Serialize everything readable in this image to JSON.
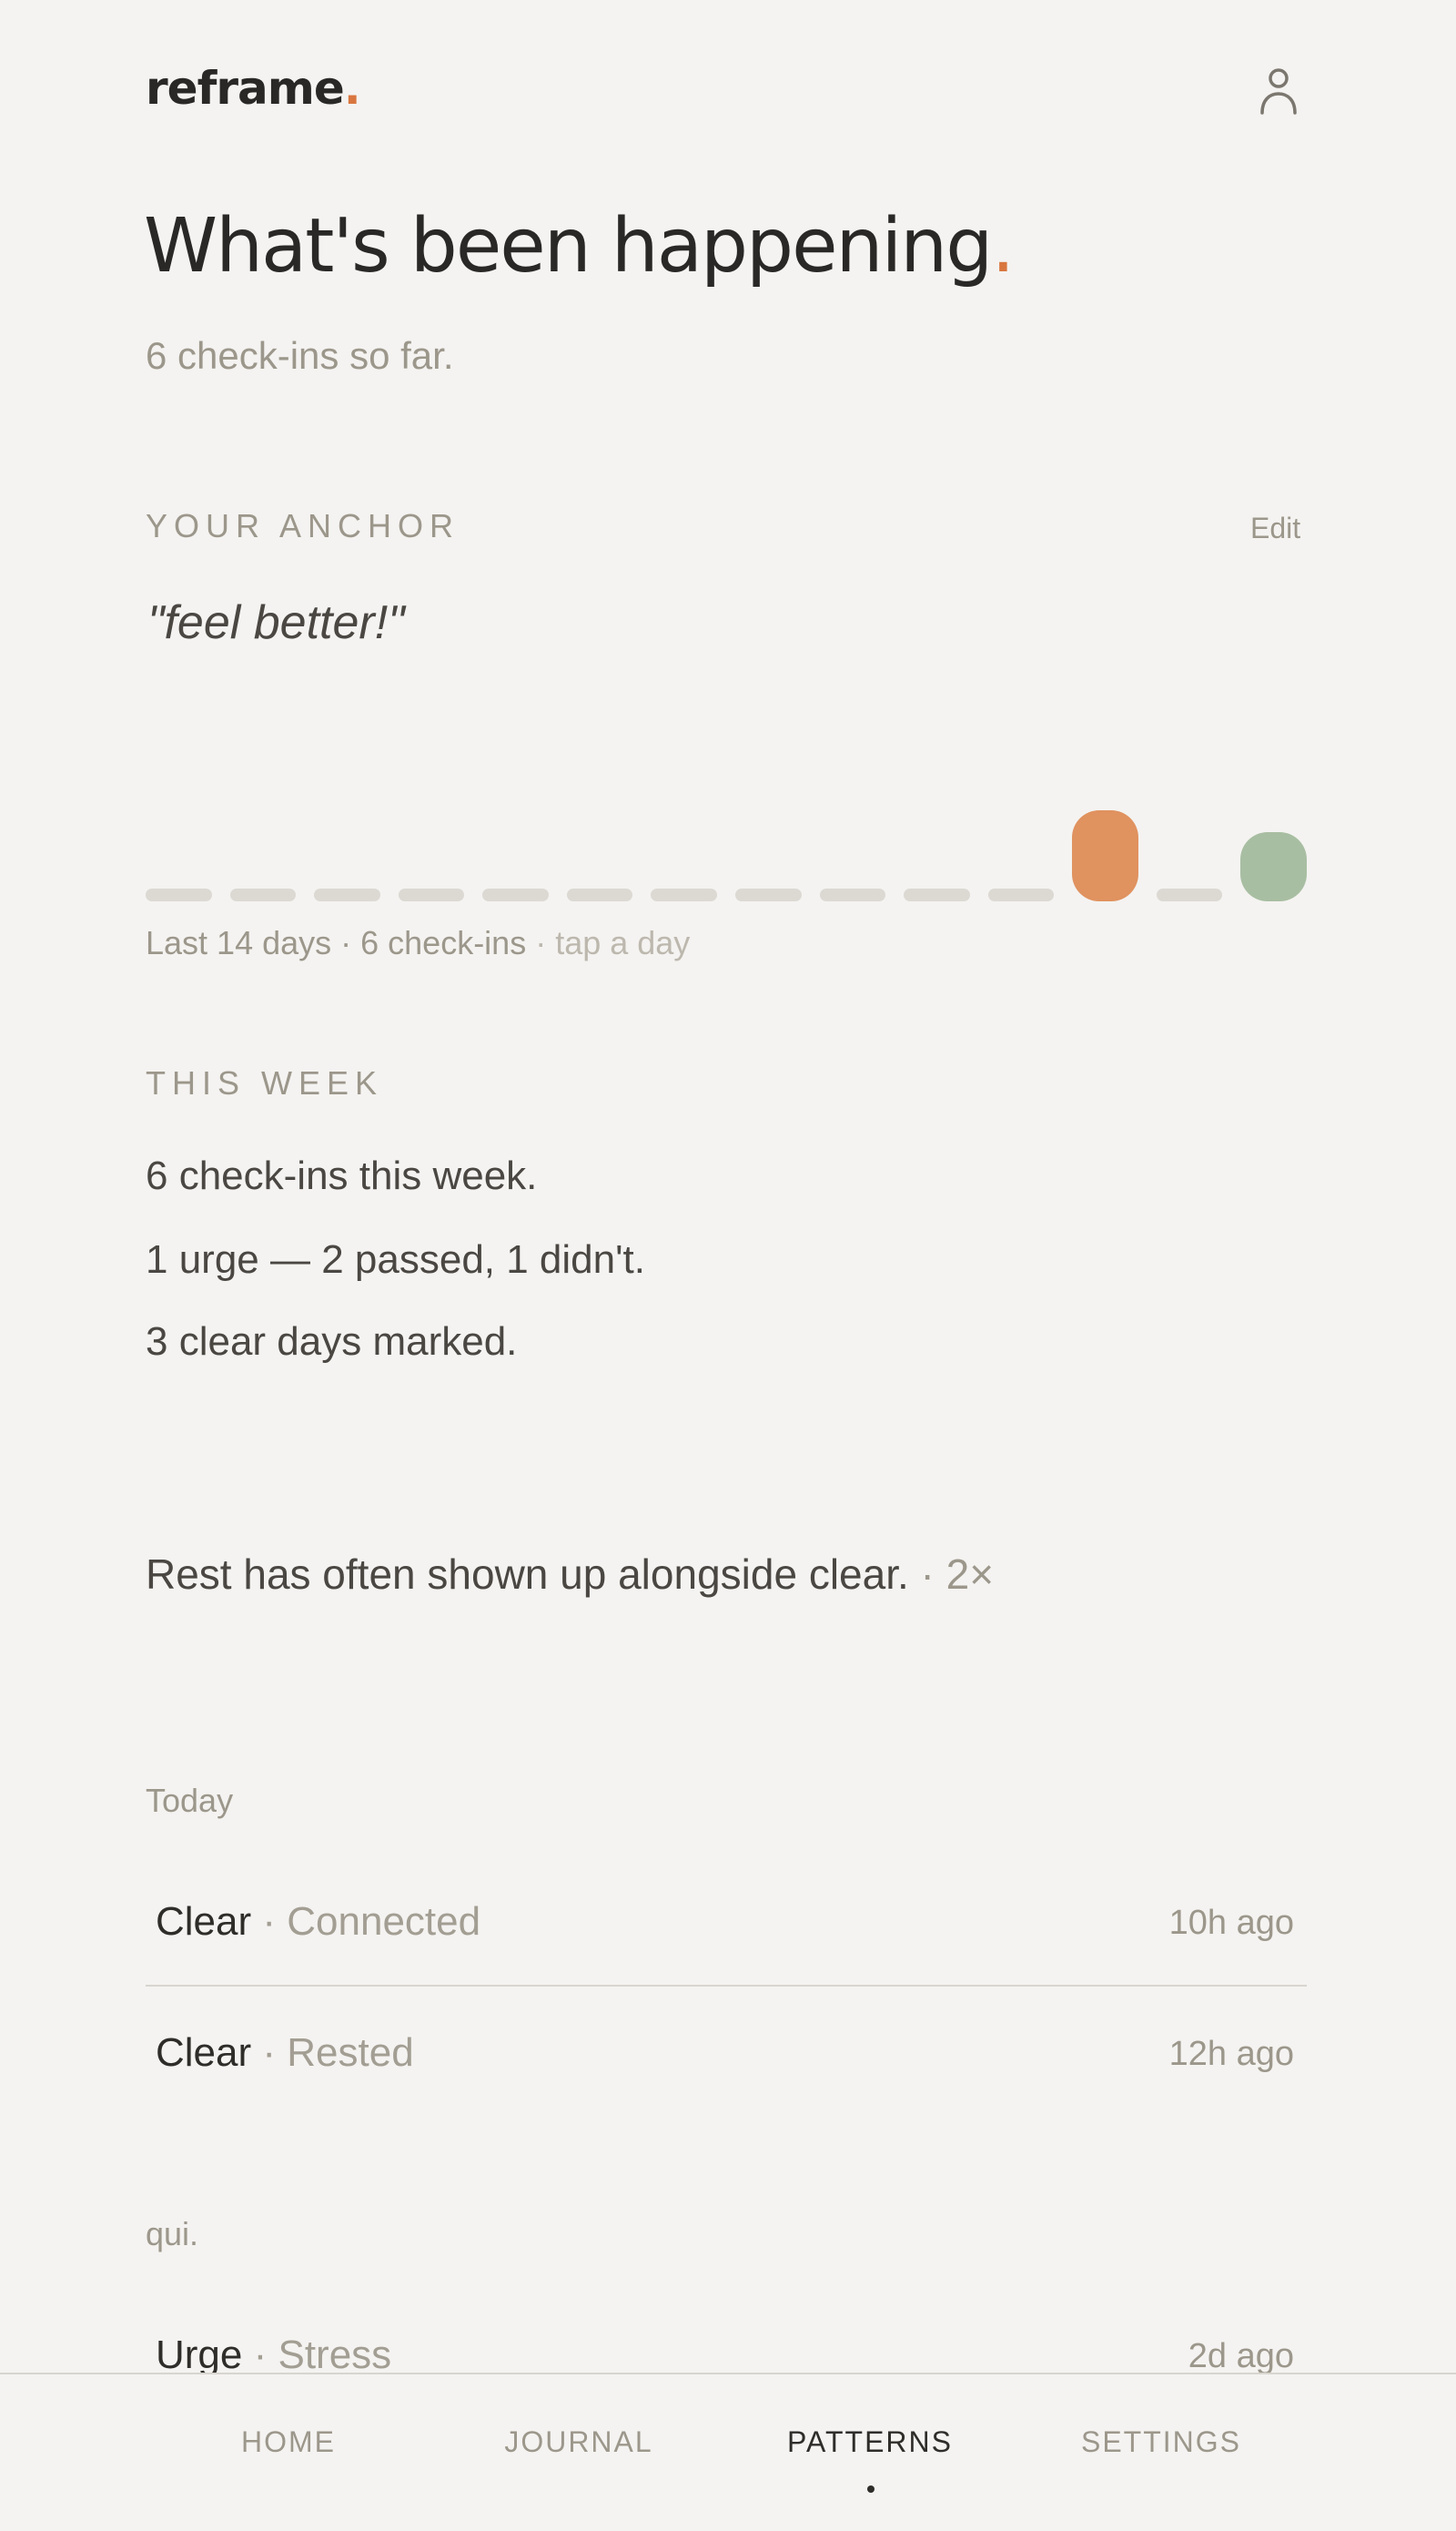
{
  "app": {
    "logo_text": "reframe",
    "logo_dot": "."
  },
  "header": {
    "title": "What's been happening",
    "title_dot": ".",
    "subtitle": "6 check-ins so far."
  },
  "anchor": {
    "label": "YOUR ANCHOR",
    "edit_label": "Edit",
    "quote": "\"feel better!\""
  },
  "day_strip": {
    "colors": {
      "empty": "#dcd9d3",
      "urge": "#e0925f",
      "clear": "#a8bea2"
    },
    "days": [
      {
        "state": "empty"
      },
      {
        "state": "empty"
      },
      {
        "state": "empty"
      },
      {
        "state": "empty"
      },
      {
        "state": "empty"
      },
      {
        "state": "empty"
      },
      {
        "state": "empty"
      },
      {
        "state": "empty"
      },
      {
        "state": "empty"
      },
      {
        "state": "empty"
      },
      {
        "state": "empty"
      },
      {
        "state": "urge"
      },
      {
        "state": "empty"
      },
      {
        "state": "clear"
      }
    ],
    "caption_main": "Last 14 days · 6 check-ins",
    "caption_hint": " · tap a day"
  },
  "this_week": {
    "label": "THIS WEEK",
    "lines": [
      "6 check-ins this week.",
      "1 urge — 2 passed, 1 didn't.",
      "3 clear days marked."
    ]
  },
  "insight": {
    "text": "Rest has often shown up alongside clear.",
    "count": " · 2×"
  },
  "timeline": {
    "groups": [
      {
        "label": "Today",
        "entries": [
          {
            "kind": "Clear",
            "tag": "Connected",
            "time": "10h ago"
          },
          {
            "kind": "Clear",
            "tag": "Rested",
            "time": "12h ago"
          }
        ]
      },
      {
        "label": "qui.",
        "entries": [
          {
            "kind": "Urge",
            "tag": "Stress",
            "time": "2d ago"
          }
        ]
      }
    ],
    "separator": " · "
  },
  "nav": {
    "items": [
      {
        "label": "HOME",
        "active": false
      },
      {
        "label": "JOURNAL",
        "active": false
      },
      {
        "label": "PATTERNS",
        "active": true
      },
      {
        "label": "SETTINGS",
        "active": false
      }
    ]
  },
  "colors": {
    "accent": "#d9763f",
    "background": "#f4f3f1",
    "text": "#2f2d2a",
    "muted": "#9c978b"
  }
}
